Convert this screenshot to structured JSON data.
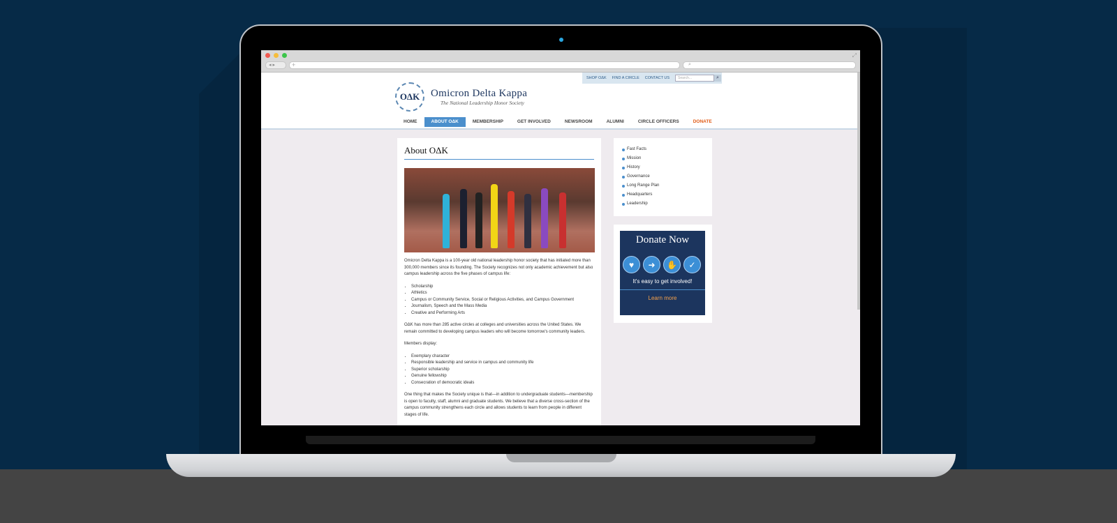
{
  "site": {
    "utility_links": [
      "SHOP OΔK",
      "FIND A CIRCLE",
      "CONTACT US"
    ],
    "search_placeholder": "Search...",
    "logo_mark": "OΔK",
    "title": "Omicron Delta Kappa",
    "subtitle": "The National Leadership Honor Society",
    "nav": [
      "HOME",
      "ABOUT OΔK",
      "MEMBERSHIP",
      "GET INVOLVED",
      "NEWSROOM",
      "ALUMNI",
      "CIRCLE OFFICERS",
      "DONATE"
    ],
    "nav_active": "ABOUT OΔK"
  },
  "main": {
    "heading": "About OΔK",
    "intro": "Omicron Delta Kappa is a 100-year old national leadership honor society that has initiated more than 300,000 members since its founding. The Society recognizes not only academic achievement but also campus leadership across the five phases of campus life:",
    "phases": [
      "Scholarship",
      "Athletics",
      "Campus or Community Service, Social or Religious Activities, and Campus Government",
      "Journalism, Speech and the Mass Media",
      "Creative and Performing Arts"
    ],
    "circles_text": "OΔK has more than 285 active circles at colleges and universities across the United States. We remain committed to developing campus leaders who will become tomorrow's community leaders.",
    "members_label": "Members display:",
    "member_traits": [
      "Exemplary character",
      "Responsible leadership and service in campus and community life",
      "Superior scholarship",
      "Genuine fellowship",
      "Consecration of democratic ideals"
    ],
    "unique_text": "One thing that makes the Society unique is that—in addition to undergraduate students—membership is open to faculty, staff, alumni and graduate students. We believe that a diverse cross-section of the campus community strengthens each circle and allows students to learn from people in different stages of life."
  },
  "sidebar": {
    "links": [
      "Fast Facts",
      "Mission",
      "History",
      "Governance",
      "Long Range Plan",
      "Headquarters",
      "Leadership"
    ]
  },
  "donate": {
    "title": "Donate Now",
    "tagline": "It's easy to get involved!",
    "cta": "Learn more",
    "icons": [
      "heart-icon",
      "arrow-icon",
      "hand-icon",
      "check-icon"
    ]
  },
  "colors": {
    "background": "#062a47",
    "accent": "#4b8fcc",
    "navy": "#1c355e",
    "donate_orange": "#e05a14"
  }
}
